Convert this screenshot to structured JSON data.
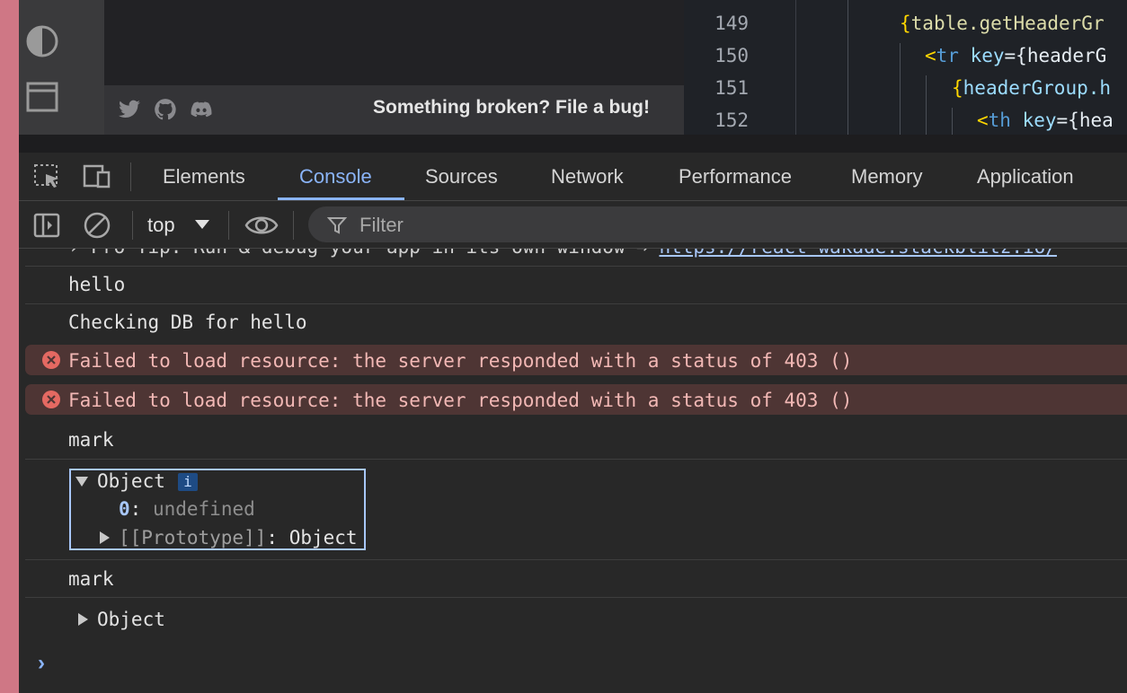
{
  "app": {
    "bug_link": "Something broken? File a bug!"
  },
  "editor": {
    "line_numbers": [
      "149",
      "150",
      "151",
      "152"
    ],
    "lines": [
      {
        "a": "{",
        "b": "table.getHeaderGr",
        "c": "",
        "d": ""
      },
      {
        "a": "<",
        "b": "tr",
        "c": " key",
        "d": "={headerG"
      },
      {
        "a": "{",
        "b": "headerGroup.h",
        "c": "",
        "d": ""
      },
      {
        "a": "<",
        "b": "th",
        "c": " key",
        "d": "={hea"
      }
    ]
  },
  "devtools": {
    "tabs": [
      "Elements",
      "Console",
      "Sources",
      "Network",
      "Performance",
      "Memory",
      "Application"
    ],
    "active_tab": "Console",
    "context": "top",
    "filter_placeholder": "Filter"
  },
  "console": {
    "partial_line": "› Pro Tip: Run & debug your app in its own window →",
    "partial_link": "https://react-wakade.stackblitz.io/",
    "messages": [
      "hello",
      "Checking DB for hello"
    ],
    "errors": [
      "Failed to load resource: the server responded with a status of 403 ()",
      "Failed to load resource: the server responded with a status of 403 ()"
    ],
    "log1": "mark",
    "object_expanded": {
      "label": "Object",
      "info": "i",
      "prop_key": "0",
      "prop_colon": ":",
      "prop_value": "undefined",
      "proto_label": "[[Prototype]]",
      "proto_colon": ":",
      "proto_value": "Object"
    },
    "log2": "mark",
    "object_collapsed": "Object",
    "prompt": "›"
  }
}
